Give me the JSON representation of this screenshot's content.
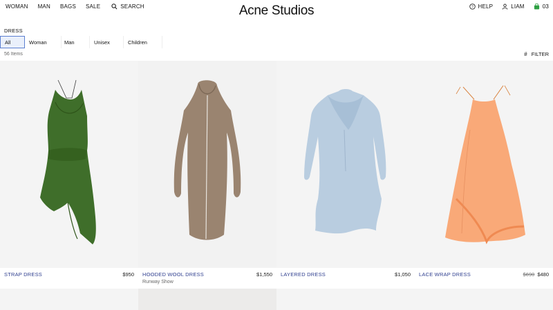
{
  "header": {
    "nav": [
      "WOMAN",
      "MAN",
      "BAGS",
      "SALE"
    ],
    "search_label": "SEARCH",
    "logo": "Acne Studios",
    "help_label": "HELP",
    "account_label": "LIAM",
    "cart_count": "03"
  },
  "breadcrumb": "DRESS",
  "filter_tabs": [
    "All",
    "Woman",
    "Man",
    "Unisex",
    "Children"
  ],
  "active_tab": "All",
  "item_count": "56 Items",
  "filter_label": "FILTER",
  "products": [
    {
      "name": "STRAP DRESS",
      "price": "$950",
      "old_price": "",
      "subtitle": "",
      "color": "#3f6e2a"
    },
    {
      "name": "HOODED WOOL DRESS",
      "price": "$1,550",
      "old_price": "",
      "subtitle": "Runway Show",
      "color": "#9a8470"
    },
    {
      "name": "LAYERED DRESS",
      "price": "$1,050",
      "old_price": "",
      "subtitle": "",
      "color": "#b9cde0"
    },
    {
      "name": "LACE WRAP DRESS",
      "price": "$480",
      "old_price": "$690",
      "subtitle": "",
      "color": "#f9a978"
    }
  ]
}
